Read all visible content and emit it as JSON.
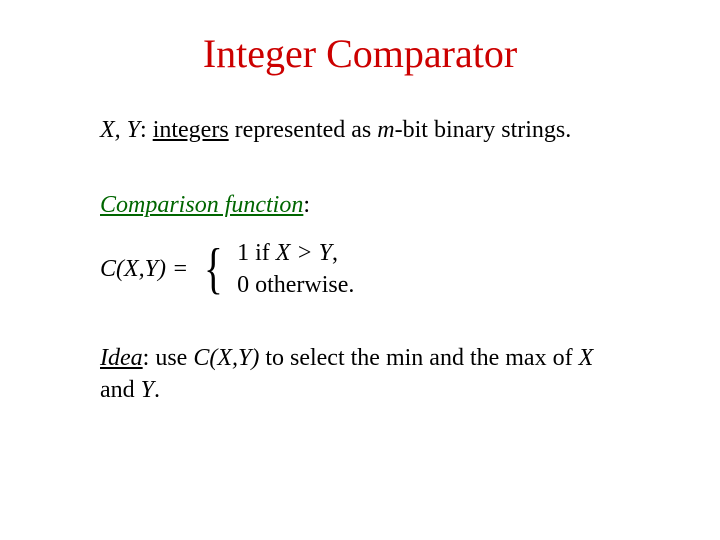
{
  "title": "Integer Comparator",
  "line1": {
    "vars": "X, Y",
    "colon": ": ",
    "integers": "integers",
    "rest1": " represented as ",
    "m": "m",
    "rest2": "-bit binary strings."
  },
  "heading2": {
    "text": "Comparison function",
    "colon": ":"
  },
  "func": {
    "lhs": "C(X,Y) =",
    "case1_num": "1",
    "case1_if": "  if  ",
    "case1_cond_pre": "X > Y",
    "case1_comma": ",",
    "case2_num": "0",
    "case2_text": "  otherwise."
  },
  "idea": {
    "label": "Idea",
    "colon": ": use ",
    "cxy": "C(X,Y)",
    "mid": " to select the min and the max of  ",
    "x": "X",
    "and": " and ",
    "y": "Y",
    "period": "."
  }
}
